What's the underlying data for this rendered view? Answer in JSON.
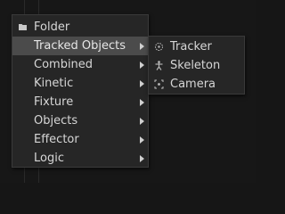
{
  "menu": {
    "items": [
      {
        "label": "Folder",
        "icon": "folder-icon",
        "has_submenu": false
      },
      {
        "label": "Tracked Objects",
        "has_submenu": true,
        "active": true
      },
      {
        "label": "Combined",
        "has_submenu": true
      },
      {
        "label": "Kinetic",
        "has_submenu": true
      },
      {
        "label": "Fixture",
        "has_submenu": true
      },
      {
        "label": "Objects",
        "has_submenu": true
      },
      {
        "label": "Effector",
        "has_submenu": true
      },
      {
        "label": "Logic",
        "has_submenu": true
      }
    ]
  },
  "submenu": {
    "items": [
      {
        "label": "Tracker",
        "icon": "tracker-icon"
      },
      {
        "label": "Skeleton",
        "icon": "skeleton-icon"
      },
      {
        "label": "Camera",
        "icon": "camera-icon"
      }
    ]
  },
  "colors": {
    "background": "#161616",
    "menu_bg": "#262626",
    "highlight": "#4b4b4b",
    "text": "#d6d6d6"
  }
}
